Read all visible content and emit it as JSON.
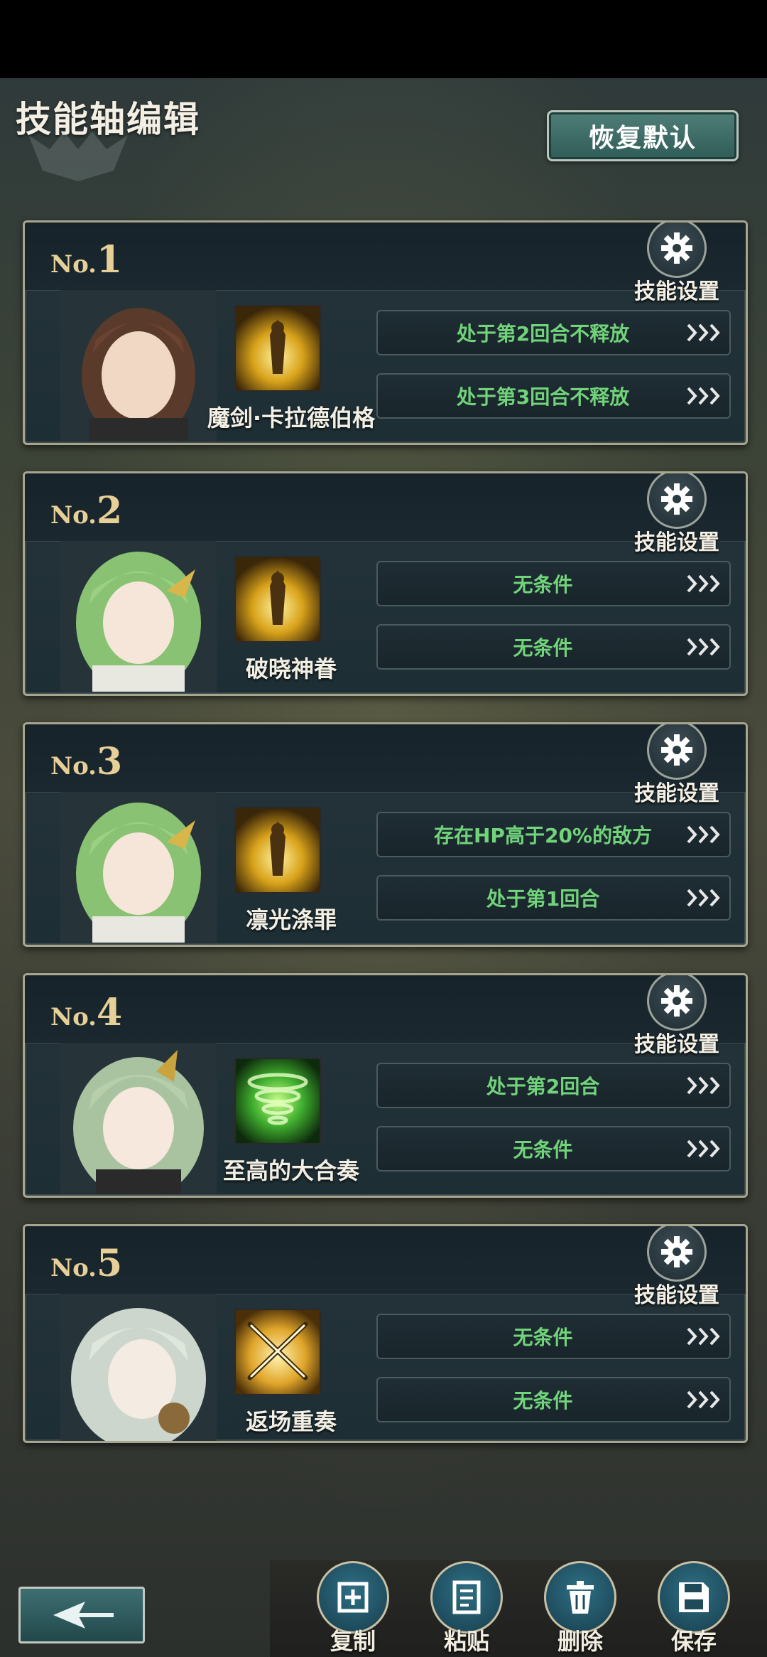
{
  "header": {
    "title": "技能轴编辑",
    "restore_label": "恢复默认"
  },
  "gear_label": "技能设置",
  "colors": {
    "condition_text": "#71d37a",
    "number_gold": "#e7cf98"
  },
  "slots": [
    {
      "prefix": "No.",
      "number": "1",
      "skill_name": "魔剑·卡拉德伯格",
      "skill_icon": "gold-warrior-icon",
      "conditions": [
        "处于第2回合不释放",
        "处于第3回合不释放"
      ]
    },
    {
      "prefix": "No.",
      "number": "2",
      "skill_name": "破晓神眷",
      "skill_icon": "gold-warrior-icon",
      "conditions": [
        "无条件",
        "无条件"
      ]
    },
    {
      "prefix": "No.",
      "number": "3",
      "skill_name": "凛光涤罪",
      "skill_icon": "gold-warrior-icon",
      "conditions": [
        "存在HP高于20%的敌方",
        "处于第1回合"
      ]
    },
    {
      "prefix": "No.",
      "number": "4",
      "skill_name": "至高的大合奏",
      "skill_icon": "green-tornado-icon",
      "conditions": [
        "处于第2回合",
        "无条件"
      ]
    },
    {
      "prefix": "No.",
      "number": "5",
      "skill_name": "返场重奏",
      "skill_icon": "crossed-swords-icon",
      "conditions": [
        "无条件",
        "无条件"
      ]
    }
  ],
  "toolbar": {
    "copy": "复制",
    "paste": "粘贴",
    "delete": "删除",
    "save": "保存"
  }
}
